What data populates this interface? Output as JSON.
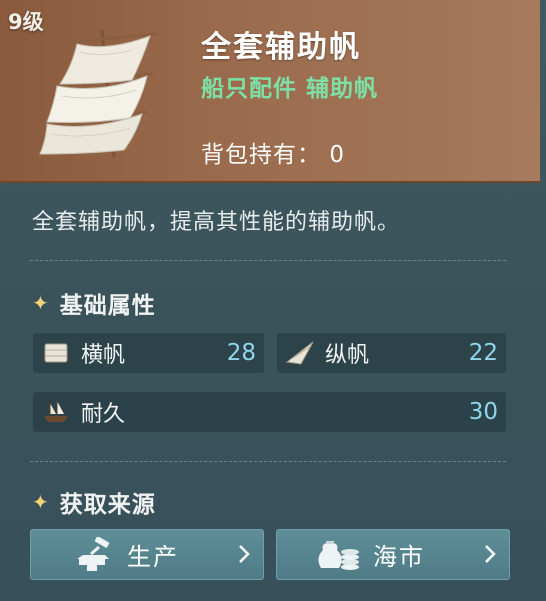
{
  "header": {
    "level": "9级",
    "title": "全套辅助帆",
    "subtitle": "船只配件  辅助帆",
    "holding_label": "背包持有：",
    "holding_value": "0"
  },
  "description": "全套辅助帆，提高其性能的辅助帆。",
  "basic_attributes": {
    "title": "基础属性",
    "stats": [
      {
        "label": "横帆",
        "value": "28",
        "icon": "square-sail-icon"
      },
      {
        "label": "纵帆",
        "value": "22",
        "icon": "fore-and-aft-sail-icon"
      },
      {
        "label": "耐久",
        "value": "30",
        "icon": "ship-durability-icon"
      }
    ]
  },
  "sources": {
    "title": "获取来源",
    "buttons": [
      {
        "label": "生产",
        "icon": "anvil-hammer-icon"
      },
      {
        "label": "海市",
        "icon": "money-bags-icon"
      }
    ]
  },
  "colors": {
    "header_bg": "#9a6a4c",
    "subtitle": "#7de0a6",
    "stat_value": "#8fd6ea",
    "button_bg": "#5a8892",
    "star": "#f3d27a"
  }
}
